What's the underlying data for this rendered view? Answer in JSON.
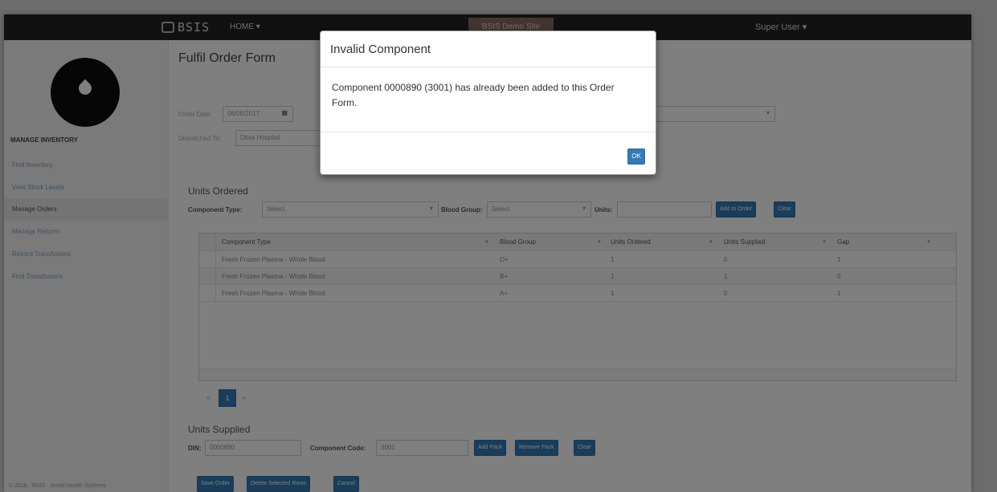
{
  "navbar": {
    "brand": "BSIS",
    "home_menu": "HOME ▾",
    "demo_badge": "BSIS Demo Site",
    "user_menu": "Super User ▾"
  },
  "sidebar": {
    "heading": "MANAGE INVENTORY",
    "items": [
      {
        "label": "Find Inventory"
      },
      {
        "label": "View Stock Levels"
      },
      {
        "label": "Manage Orders"
      },
      {
        "label": "Manage Returns"
      },
      {
        "label": "Record Transfusions"
      },
      {
        "label": "Find Transfusions"
      }
    ],
    "footer": "© 2016 · BSIS · Jembi Health Systems"
  },
  "form": {
    "title": "Fulfil Order Form",
    "order_date_label": "Order Date:",
    "order_date_value": "06/06/2017",
    "dispatched_to_label": "Dispatched To:",
    "dispatched_to_value": "Ditsa Hospital"
  },
  "units_ordered": {
    "title": "Units Ordered",
    "component_type_label": "Component Type:",
    "component_type_placeholder": "Select",
    "blood_group_label": "Blood Group:",
    "blood_group_placeholder": "Select",
    "units_label": "Units:",
    "add_to_order": "Add to Order",
    "clear": "Clear"
  },
  "grid": {
    "columns": [
      "Component Type",
      "Blood Group",
      "Units Ordered",
      "Units Supplied",
      "Gap"
    ],
    "rows": [
      [
        "Fresh Frozen Plasma - Whole Blood",
        "O+",
        "1",
        "0",
        "1"
      ],
      [
        "Fresh Frozen Plasma - Whole Blood",
        "B+",
        "1",
        "1",
        "0"
      ],
      [
        "Fresh Frozen Plasma - Whole Blood",
        "A+",
        "1",
        "0",
        "1"
      ]
    ]
  },
  "pager": {
    "prev": "«",
    "page": "1",
    "next": "»"
  },
  "units_supplied": {
    "title": "Units Supplied",
    "din_label": "DIN:",
    "din_value": "0000890",
    "component_code_label": "Component Code:",
    "component_code_value": "3001",
    "add_pack": "Add Pack",
    "remove_pack": "Remove Pack",
    "clear": "Clear"
  },
  "actions": {
    "save_order": "Save Order",
    "delete_selected": "Delete Selected Rows",
    "cancel": "Cancel"
  },
  "modal": {
    "title": "Invalid Component",
    "message": "Component 0000890 (3001) has already been added to this Order Form.",
    "ok": "OK"
  }
}
